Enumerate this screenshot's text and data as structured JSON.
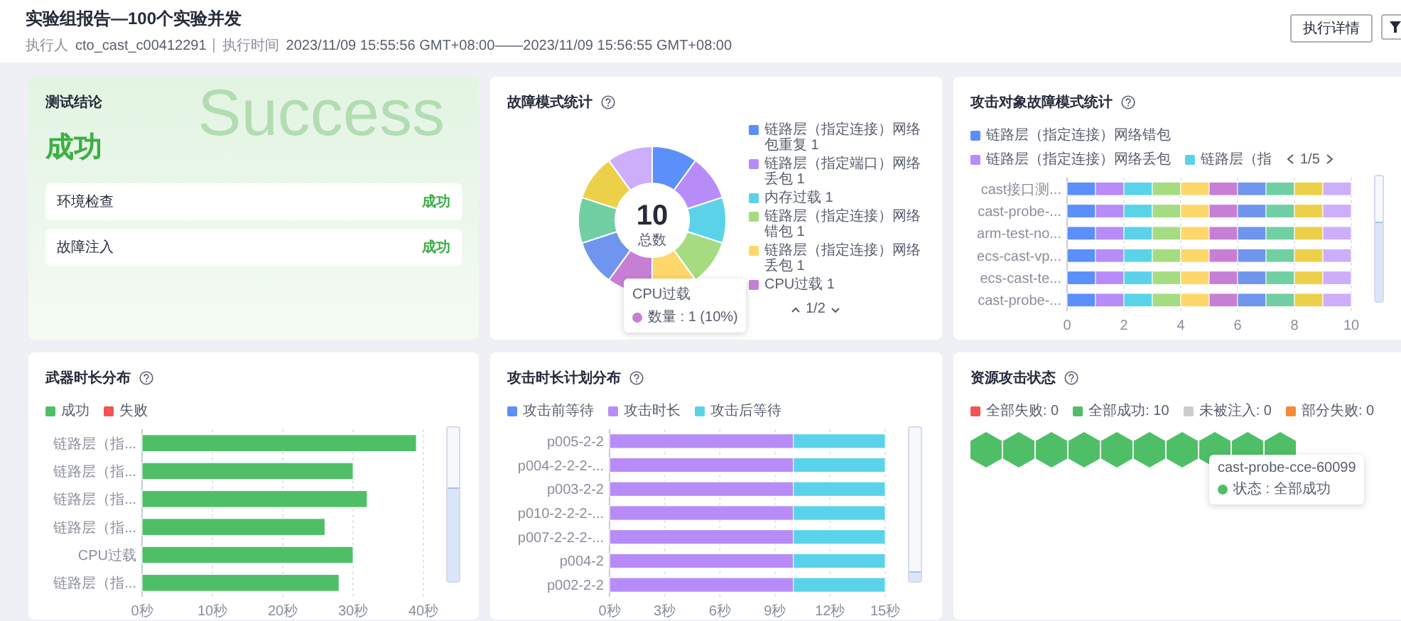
{
  "header": {
    "title": "实验组报告—100个实验并发",
    "executor_label": "执行人",
    "executor": "cto_cast_c00412291",
    "time_label": "执行时间",
    "time": "2023/11/09 15:55:56 GMT+08:00——2023/11/09 15:56:55 GMT+08:00",
    "buttons": [
      "执行详情"
    ]
  },
  "conclusion": {
    "title": "测试结论",
    "watermark": "Success",
    "result": "成功",
    "checks": [
      {
        "label": "环境检查",
        "result": "成功"
      },
      {
        "label": "故障注入",
        "result": "成功"
      }
    ]
  },
  "fault_modes": {
    "title": "故障模式统计",
    "total": "10",
    "total_label": "总数",
    "pager": "1/2",
    "legend": [
      {
        "label": "链路层（指定连接）网络包重复 1",
        "color": "#5b8ff9"
      },
      {
        "label": "链路层（指定端口）网络丢包 1",
        "color": "#b78cf9"
      },
      {
        "label": "内存过载 1",
        "color": "#5ad3ea"
      },
      {
        "label": "链路层（指定连接）网络错包 1",
        "color": "#a5dc82"
      },
      {
        "label": "链路层（指定连接）网络丢包 1",
        "color": "#fdd76a"
      },
      {
        "label": "CPU过载 1",
        "color": "#c77fd6"
      }
    ],
    "slices": [
      {
        "color": "#5b8ff9"
      },
      {
        "color": "#b78cf9"
      },
      {
        "color": "#5ad3ea"
      },
      {
        "color": "#a5dc82"
      },
      {
        "color": "#fdd76a"
      },
      {
        "color": "#c77fd6"
      },
      {
        "color": "#6f95ee"
      },
      {
        "color": "#71cfa4"
      },
      {
        "color": "#edd04a"
      },
      {
        "color": "#cdaefb"
      }
    ],
    "chart_data": {
      "type": "donut",
      "values": [
        10,
        10,
        10,
        10,
        10,
        10,
        10,
        10,
        10,
        10
      ]
    },
    "tooltip": {
      "title": "CPU过载",
      "text": "数量 : 1 (10%)",
      "color": "#c77fd6"
    }
  },
  "target_modes": {
    "title": "攻击对象故障模式统计",
    "pager": "1/5",
    "slider": {
      "level": 0.62
    },
    "chart_data": {
      "type": "bar",
      "orientation": "horizontal",
      "stacked": true,
      "grid": true,
      "xlim": [
        0,
        10
      ],
      "categories": [
        "cast接口测...",
        "cast-probe-...",
        "arm-test-no...",
        "ecs-cast-vp...",
        "ecs-cast-te...",
        "cast-probe-..."
      ],
      "xticks": [
        0,
        2,
        4,
        6,
        8,
        10
      ],
      "series": [
        {
          "name": "链路层（指定连接）网络错包",
          "color": "#5b8ff9",
          "values": [
            1,
            1,
            1,
            1,
            1,
            1
          ]
        },
        {
          "name": "链路层（指定连接）网络丢包",
          "color": "#b78cf9",
          "values": [
            1,
            1,
            1,
            1,
            1,
            1
          ]
        },
        {
          "name": "链路层（指",
          "color": "#5ad3ea",
          "values": [
            1,
            1,
            1,
            1,
            1,
            1
          ]
        },
        {
          "color": "#a5dc82",
          "values": [
            1,
            1,
            1,
            1,
            1,
            1
          ]
        },
        {
          "color": "#fdd76a",
          "values": [
            1,
            1,
            1,
            1,
            1,
            1
          ]
        },
        {
          "color": "#c77fd6",
          "values": [
            1,
            1,
            1,
            1,
            1,
            1
          ]
        },
        {
          "color": "#6f95ee",
          "values": [
            1,
            1,
            1,
            1,
            1,
            1
          ]
        },
        {
          "color": "#71cfa4",
          "values": [
            1,
            1,
            1,
            1,
            1,
            1
          ]
        },
        {
          "color": "#edd04a",
          "values": [
            1,
            1,
            1,
            1,
            1,
            1
          ]
        },
        {
          "color": "#cdaefb",
          "values": [
            1,
            1,
            1,
            1,
            1,
            1
          ]
        }
      ]
    }
  },
  "weapon_duration": {
    "title": "武器时长分布",
    "slider": {
      "level": 0.6
    },
    "chart_data": {
      "type": "bar",
      "orientation": "horizontal",
      "stacked": true,
      "grid": true,
      "xlim": [
        0,
        40
      ],
      "categories": [
        "链路层（指...",
        "链路层（指...",
        "链路层（指...",
        "链路层（指...",
        "CPU过载",
        "链路层（指..."
      ],
      "xticks": [
        {
          "value": 0,
          "label": "0秒"
        },
        {
          "value": 10,
          "label": "10秒"
        },
        {
          "value": 20,
          "label": "20秒"
        },
        {
          "value": 30,
          "label": "30秒"
        },
        {
          "value": 40,
          "label": "40秒"
        }
      ],
      "series": [
        {
          "name": "成功",
          "color": "#4fbf67",
          "values": [
            39,
            30,
            32,
            26,
            30,
            28
          ]
        },
        {
          "name": "失败",
          "color": "#f25353",
          "values": [
            0,
            0,
            0,
            0,
            0,
            0
          ]
        }
      ]
    }
  },
  "attack_plan": {
    "title": "攻击时长计划分布",
    "slider": {
      "level": 0.06
    },
    "chart_data": {
      "type": "bar",
      "orientation": "horizontal",
      "stacked": true,
      "grid": true,
      "xlim": [
        0,
        15
      ],
      "categories": [
        "p005-2-2",
        "p004-2-2-2-...",
        "p003-2-2",
        "p010-2-2-2-...",
        "p007-2-2-2-...",
        "p004-2",
        "p002-2-2"
      ],
      "xticks": [
        {
          "value": 0,
          "label": "0秒"
        },
        {
          "value": 3,
          "label": "3秒"
        },
        {
          "value": 6,
          "label": "6秒"
        },
        {
          "value": 9,
          "label": "9秒"
        },
        {
          "value": 12,
          "label": "12秒"
        },
        {
          "value": 15,
          "label": "15秒"
        }
      ],
      "series": [
        {
          "name": "攻击前等待",
          "color": "#5b8ff9",
          "values": [
            0,
            0,
            0,
            0,
            0,
            0,
            0
          ]
        },
        {
          "name": "攻击时长",
          "color": "#b78cf9",
          "values": [
            10,
            10,
            10,
            10,
            10,
            10,
            10
          ]
        },
        {
          "name": "攻击后等待",
          "color": "#5ad3ea",
          "values": [
            5,
            5,
            5,
            5,
            5,
            5,
            5
          ]
        }
      ]
    }
  },
  "resource_status": {
    "title": "资源攻击状态",
    "legend": [
      {
        "label": "全部失败: 0",
        "color": "#f25353"
      },
      {
        "label": "全部成功: 10",
        "color": "#4fbf67"
      },
      {
        "label": "未被注入: 0",
        "color": "#cccccc"
      },
      {
        "label": "部分失败: 0",
        "color": "#f7893b"
      }
    ],
    "cells": [
      {
        "color": "#4fbf67"
      },
      {
        "color": "#4fbf67"
      },
      {
        "color": "#4fbf67"
      },
      {
        "color": "#4fbf67"
      },
      {
        "color": "#4fbf67"
      },
      {
        "color": "#4fbf67"
      },
      {
        "color": "#4fbf67"
      },
      {
        "color": "#4fbf67"
      },
      {
        "color": "#4fbf67"
      },
      {
        "color": "#4fbf67"
      }
    ],
    "tooltip": {
      "title": "cast-probe-cce-60099",
      "text": "状态 : 全部成功",
      "color": "#4fbf67"
    }
  }
}
